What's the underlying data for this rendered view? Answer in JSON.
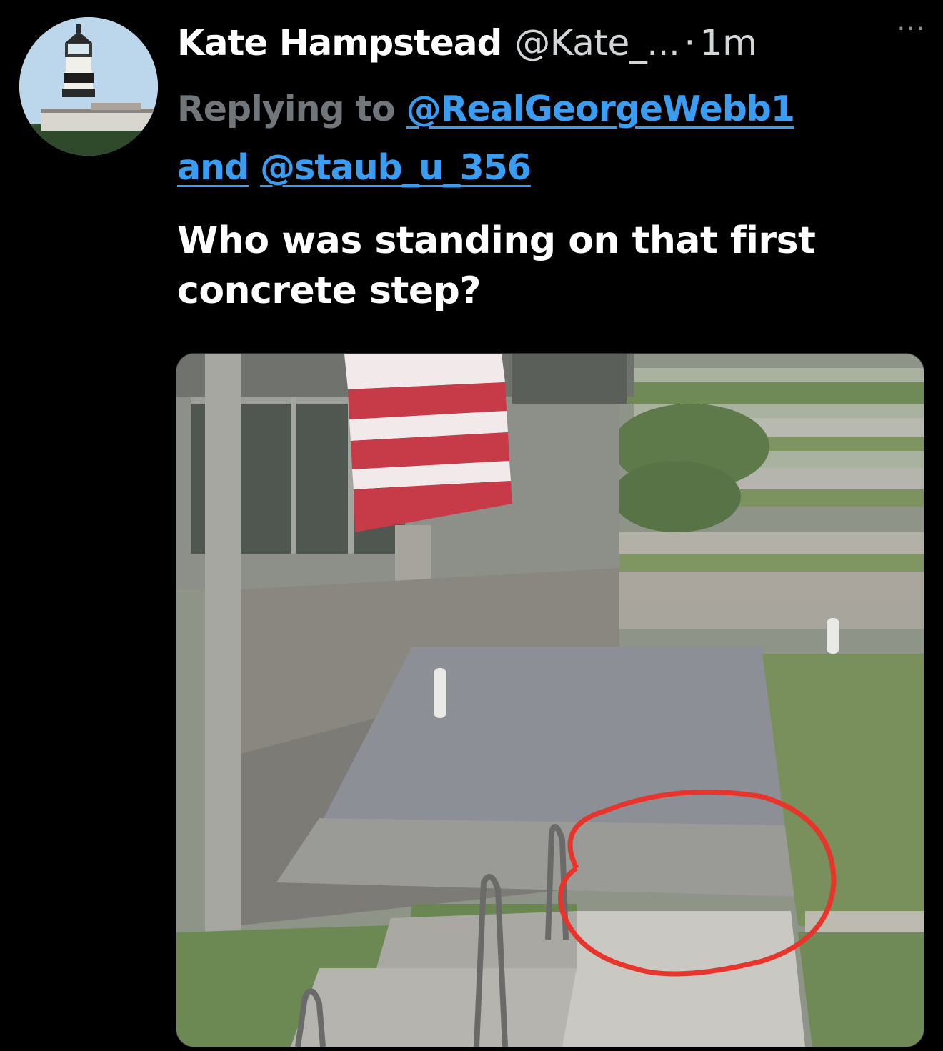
{
  "tweet": {
    "author_name": "Kate Hampstead",
    "author_handle": "@Kate_...",
    "separator": "·",
    "time": "1m",
    "more_label": "···",
    "replying_prefix": "Replying to",
    "reply_to_1": "@RealGeorgeWebb1",
    "reply_joiner": "and",
    "reply_to_2": "@staub_u_356",
    "text": "Who was standing on that first concrete step?"
  },
  "media": {
    "description_icon": "photo",
    "annotation_color": "#e8352c",
    "flag_red": "#c73a48",
    "flag_white": "#f2eaea"
  },
  "avatar": {
    "icon": "lighthouse-icon"
  }
}
